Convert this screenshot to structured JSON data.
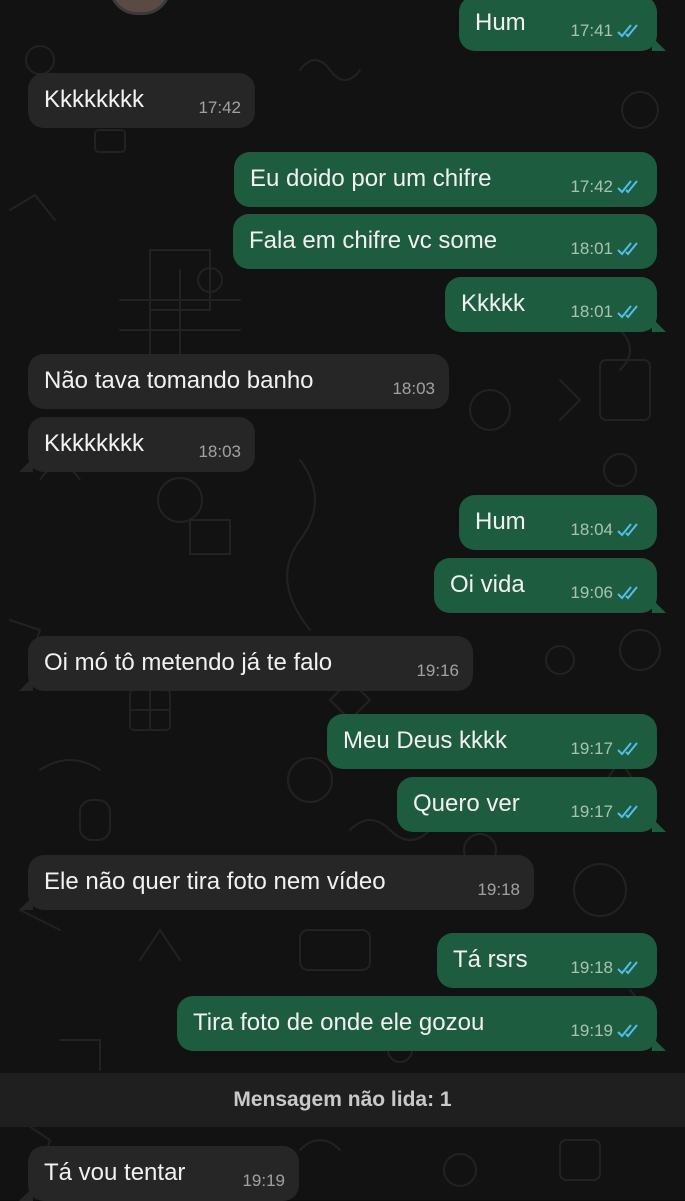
{
  "colors": {
    "background": "#121212",
    "incoming_bubble": "#262626",
    "outgoing_bubble": "#1d5c3f",
    "read_tick": "#53bdeb",
    "text": "#f1f1f1"
  },
  "messages": [
    {
      "id": "m1",
      "dir": "out",
      "text": "Hum",
      "time": "17:41",
      "ticks": "read-double-check-icon"
    },
    {
      "id": "m2",
      "dir": "in",
      "text": "Kkkkkkkk",
      "time": "17:42"
    },
    {
      "id": "m3",
      "dir": "out",
      "text": "Eu doido por um chifre",
      "time": "17:42",
      "ticks": "read-double-check-icon"
    },
    {
      "id": "m4",
      "dir": "out",
      "text": "Fala em chifre vc some",
      "time": "18:01",
      "ticks": "read-double-check-icon"
    },
    {
      "id": "m5",
      "dir": "out",
      "text": "Kkkkk",
      "time": "18:01",
      "ticks": "read-double-check-icon"
    },
    {
      "id": "m6",
      "dir": "in",
      "text": "Não tava tomando banho",
      "time": "18:03"
    },
    {
      "id": "m7",
      "dir": "in",
      "text": "Kkkkkkkk",
      "time": "18:03"
    },
    {
      "id": "m8",
      "dir": "out",
      "text": "Hum",
      "time": "18:04",
      "ticks": "read-double-check-icon"
    },
    {
      "id": "m9",
      "dir": "out",
      "text": "Oi vida",
      "time": "19:06",
      "ticks": "read-double-check-icon"
    },
    {
      "id": "m10",
      "dir": "in",
      "text": "Oi mó tô metendo já te falo",
      "time": "19:16"
    },
    {
      "id": "m11",
      "dir": "out",
      "text": "Meu Deus kkkk",
      "time": "19:17",
      "ticks": "read-double-check-icon"
    },
    {
      "id": "m12",
      "dir": "out",
      "text": "Quero ver",
      "time": "19:17",
      "ticks": "read-double-check-icon"
    },
    {
      "id": "m13",
      "dir": "in",
      "text": "Ele não quer tira foto nem vídeo",
      "time": "19:18"
    },
    {
      "id": "m14",
      "dir": "out",
      "text": "Tá rsrs",
      "time": "19:18",
      "ticks": "read-double-check-icon"
    },
    {
      "id": "m15",
      "dir": "out",
      "text": "Tira foto de onde ele gozou",
      "time": "19:19",
      "ticks": "read-double-check-icon"
    },
    {
      "id": "m16",
      "dir": "in",
      "text": "Tá vou tentar",
      "time": "19:19"
    }
  ],
  "unread_banner": "Mensagem não lida: 1"
}
